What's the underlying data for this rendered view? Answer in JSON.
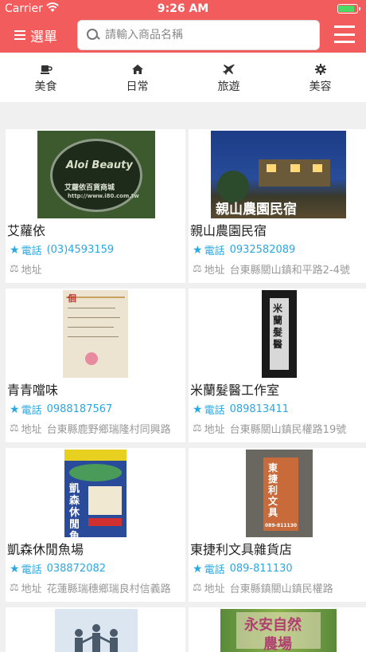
{
  "status_bar": {
    "carrier": "Carrier",
    "time": "9:26 AM"
  },
  "nav": {
    "menu_label": "選單",
    "search_placeholder": "請輸入商品名稱"
  },
  "categories": [
    {
      "label": "美食",
      "icon": "coffee-cup-icon"
    },
    {
      "label": "日常",
      "icon": "home-icon"
    },
    {
      "label": "旅遊",
      "icon": "airplane-icon"
    },
    {
      "label": "美容",
      "icon": "gear-icon"
    }
  ],
  "phone_label": "電話",
  "address_label": "地址",
  "stores": [
    {
      "name": "艾蘿依",
      "phone": "(03)4593159",
      "address": "",
      "sign_text": [
        "Aloi Beauty",
        "艾蘿依百貨商城",
        "http://www.i80.com.tw"
      ]
    },
    {
      "name": "親山農園民宿",
      "phone": "0932582089",
      "address": "台東縣關山鎮和平路2-4號",
      "sign_text": [
        "親山農園民宿"
      ]
    },
    {
      "name": "青青噹味",
      "phone": "0988187567",
      "address": "台東縣鹿野鄉瑞隆村同興路",
      "sign_text": [
        "佪"
      ]
    },
    {
      "name": "米蘭髮醫工作室",
      "phone": "089813411",
      "address": "台東縣關山鎮民權路19號",
      "sign_text": [
        "米蘭髮醫"
      ]
    },
    {
      "name": "凱森休閒魚場",
      "phone": "038872082",
      "address": "花蓮縣瑞穗鄉瑞良村信義路",
      "sign_text": [
        "凱森休閒魚池"
      ]
    },
    {
      "name": "東捷利文具雜貨店",
      "phone": "089-811130",
      "address": "台東縣鎮關山鎮民權路",
      "sign_text": [
        "東捷利文具",
        "089-811130"
      ]
    },
    {
      "name": "",
      "phone": "",
      "address": "",
      "sign_text": []
    },
    {
      "name": "",
      "phone": "",
      "address": "",
      "sign_text": [
        "永安自然",
        "農場"
      ]
    }
  ]
}
